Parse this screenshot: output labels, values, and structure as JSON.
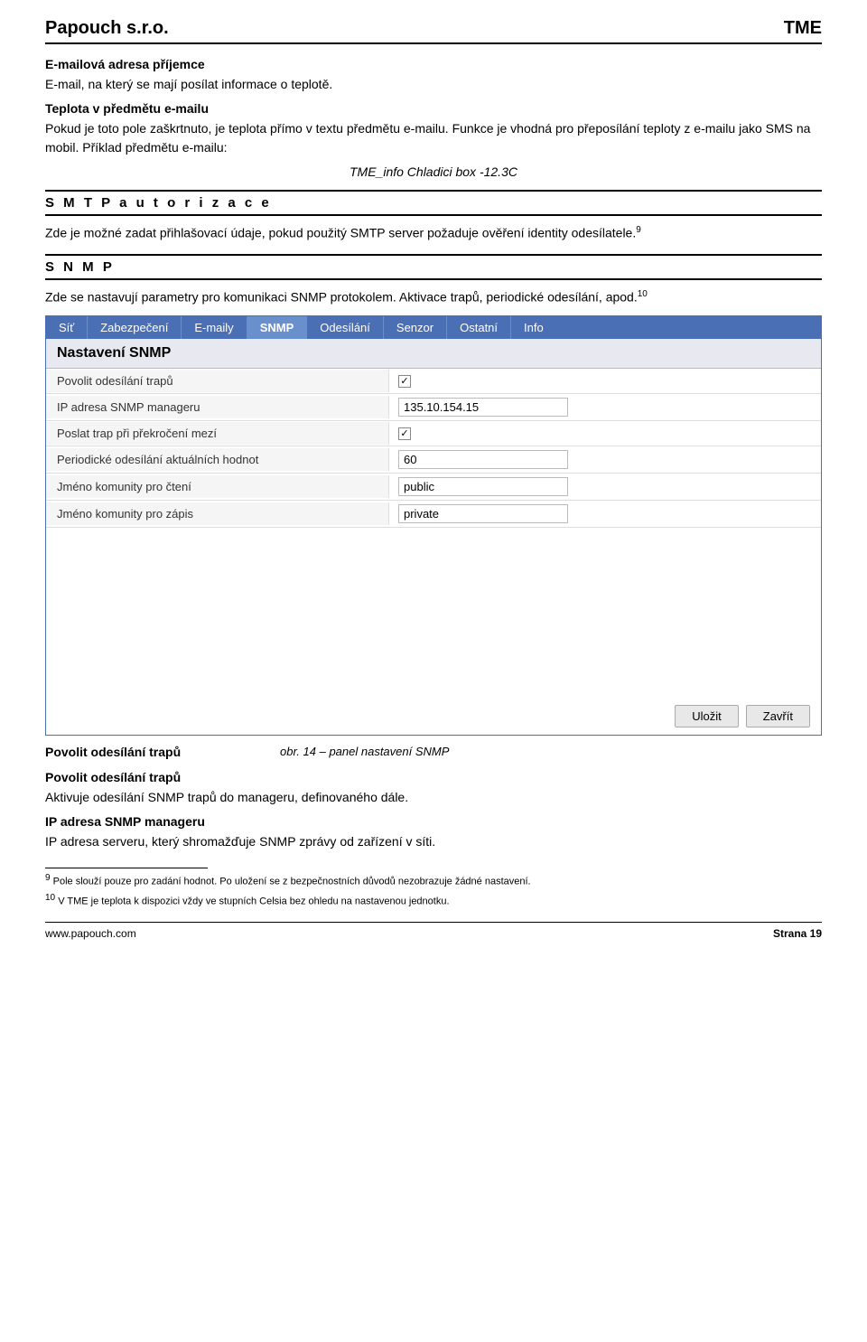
{
  "header": {
    "company": "Papouch s.r.o.",
    "product": "TME"
  },
  "sections": {
    "emailAddress": {
      "heading": "E-mailová adresa příjemce",
      "text": "E-mail, na který se mají posílat informace o teplotě."
    },
    "emailSubject": {
      "heading": "Teplota v předmětu e-mailu",
      "text": "Pokud je toto pole zaškrtnuto, je teplota přímo v textu předmětu e-mailu. Funkce je vhodná pro přeposílání teploty z e-mailu jako SMS na mobil. Příklad předmětu e-mailu:",
      "example": "TME_info Chladici box -12.3C"
    },
    "smtp": {
      "heading": "S M T P   a u t o r i z a c e",
      "text": "Zde je možné zadat přihlašovací údaje, pokud použitý SMTP server požaduje ověření identity odesílatele.",
      "superscript": "9"
    },
    "snmp": {
      "heading": "S N M P",
      "text1": "Zde se nastavují parametry pro komunikaci SNMP protokolem. Aktivace trapů, periodické odesílání, apod.",
      "superscript": "10"
    }
  },
  "snmpPanel": {
    "tabs": [
      {
        "label": "Síť",
        "active": false
      },
      {
        "label": "Zabezpečení",
        "active": false
      },
      {
        "label": "E-maily",
        "active": false
      },
      {
        "label": "SNMP",
        "active": true
      },
      {
        "label": "Odesílání",
        "active": false
      },
      {
        "label": "Senzor",
        "active": false
      },
      {
        "label": "Ostatní",
        "active": false
      },
      {
        "label": "Info",
        "active": false
      }
    ],
    "title": "Nastavení SNMP",
    "rows": [
      {
        "label": "Povolit odesílání trapů",
        "value": "checkbox",
        "checked": true
      },
      {
        "label": "IP adresa SNMP manageru",
        "value": "text",
        "content": "135.10.154.15"
      },
      {
        "label": "Poslat trap při překročení mezí",
        "value": "checkbox",
        "checked": true
      },
      {
        "label": "Periodické odesílání aktuálních hodnot",
        "value": "text",
        "content": "60"
      },
      {
        "label": "Jméno komunity pro čtení",
        "value": "text",
        "content": "public"
      },
      {
        "label": "Jméno komunity pro zápis",
        "value": "text",
        "content": "private"
      }
    ],
    "buttons": {
      "save": "Uložit",
      "close": "Zavřít"
    }
  },
  "figCaption": {
    "sectionLabel": "Povolit odesílání trapů",
    "captionText": "obr. 14 – panel nastavení SNMP"
  },
  "postCaption": {
    "heading1": "Povolit odesílání trapů",
    "text1": "Aktivuje odesílání SNMP trapů do manageru, definovaného dále.",
    "heading2": "IP adresa SNMP manageru",
    "text2": "IP adresa serveru, který shromažďuje SNMP zprávy od zařízení v síti."
  },
  "footnotes": [
    {
      "number": "9",
      "text": "Pole slouží pouze pro zadání hodnot. Po uložení se z bezpečnostních důvodů nezobrazuje žádné nastavení."
    },
    {
      "number": "10",
      "text": "V TME je teplota k dispozici vždy ve stupních Celsia bez ohledu na nastavenou jednotku."
    }
  ],
  "footer": {
    "url": "www.papouch.com",
    "page": "Strana 19"
  }
}
